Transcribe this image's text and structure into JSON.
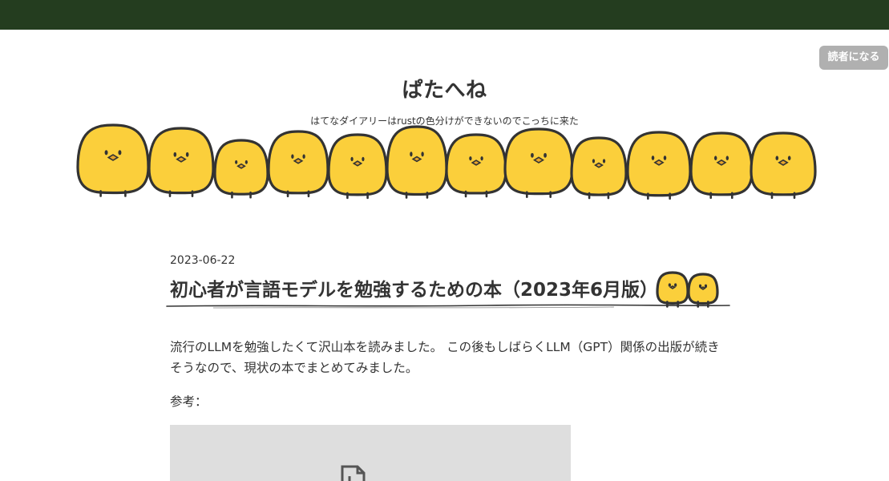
{
  "header": {
    "bar_color": "#243d1f",
    "subscribe_label": "読者になる"
  },
  "blog": {
    "title": "ぱたへね",
    "description": "はてなダイアリーはrustの色分けができないのでこっちに来た",
    "banner_icon": "yellow-chick-icon",
    "chick_color": "#fbcf3b"
  },
  "entry": {
    "date": "2023-06-22",
    "title": "初心者が言語モデルを勉強するための本（2023年6月版）",
    "body": "流行のLLMを勉強したくて沢山本を読みました。 この後もしばらくLLM（GPT）関係の出版が続きそうなので、現状の本でまとめてみました。",
    "reference_label": "参考：",
    "embed_icon": "broken-image-icon"
  }
}
